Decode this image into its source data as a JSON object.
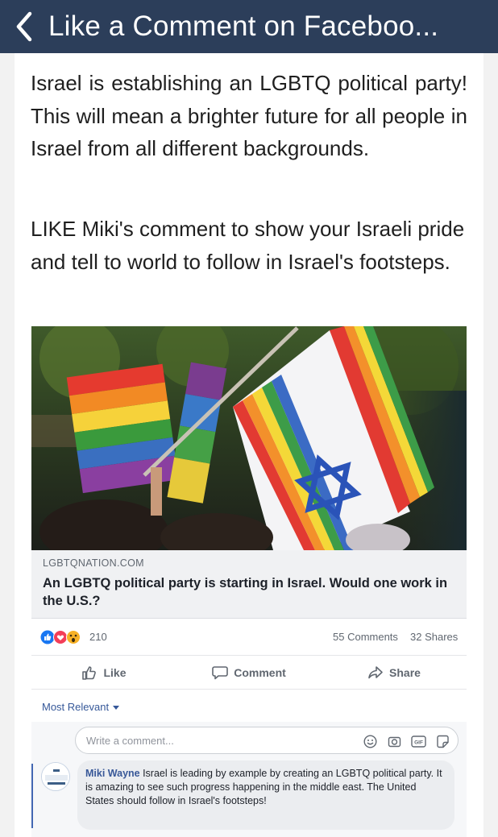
{
  "header": {
    "title": "Like a Comment on Faceboo..."
  },
  "body": {
    "paragraph1": "Israel is establishing an LGBTQ political party! This will mean a brighter future for all people in Israel from all different backgrounds.",
    "paragraph2": "LIKE Miki's comment to show your Israeli pride and tell to world to follow in Israel's footsteps."
  },
  "link": {
    "domain": "LGBTQNATION.COM",
    "headline": "An LGBTQ political party is starting in Israel. Would one work in the U.S.?"
  },
  "stats": {
    "reactions": "210",
    "comments": "55 Comments",
    "shares": "32 Shares"
  },
  "actions": {
    "like": "Like",
    "comment": "Comment",
    "share": "Share"
  },
  "sort": {
    "label": "Most Relevant"
  },
  "composer": {
    "placeholder": "Write a comment..."
  },
  "comment": {
    "author": "Miki Wayne",
    "text": " Israel is leading by example by creating an LGBTQ political party. It is amazing to see such progress happening in the middle east. The United States should follow in Israel's footsteps!"
  },
  "colors": {
    "topbar": "#2c3e5a",
    "facebook_blue": "#4267b2",
    "link_blue": "#385898"
  }
}
